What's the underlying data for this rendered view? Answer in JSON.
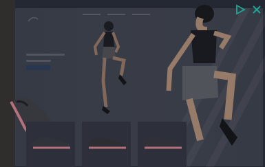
{
  "ad": {
    "background_color": "#272b36",
    "accent_color": "#2b3b56",
    "shoe_accent": "#c07a84",
    "nav_items": [
      "",
      "",
      ""
    ]
  },
  "controls": {
    "adchoices_icon": "play-triangle-icon",
    "close_icon": "close-icon",
    "icon_color": "#1fb5a0"
  },
  "products": [
    {
      "name": "shoe-1"
    },
    {
      "name": "shoe-2"
    },
    {
      "name": "shoe-3"
    }
  ]
}
